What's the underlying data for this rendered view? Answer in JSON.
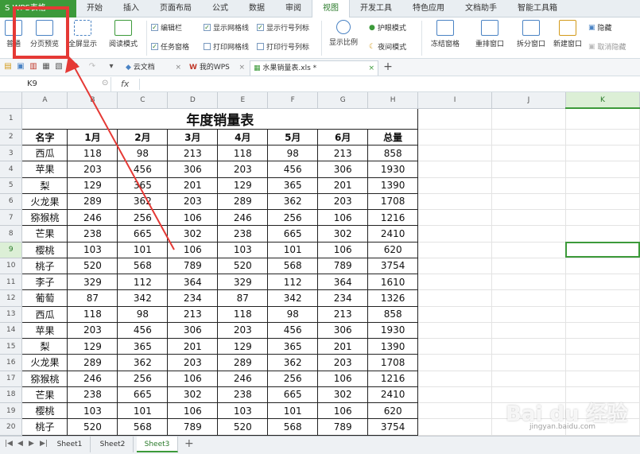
{
  "app": {
    "name": "S WPS表格"
  },
  "menu": {
    "tabs": [
      "开始",
      "插入",
      "页面布局",
      "公式",
      "数据",
      "审阅",
      "视图",
      "开发工具",
      "特色应用",
      "文档助手",
      "智能工具箱"
    ],
    "active": "视图"
  },
  "ribbon": {
    "normal": "普通",
    "page_break_preview": "分页预览",
    "full_screen": "全屏显示",
    "reading_mode": "阅读模式",
    "edit_bar": "编辑栏",
    "task_pane": "任务窗格",
    "show_gridlines": "显示网格线",
    "print_gridlines": "打印网格线",
    "show_row_col_headers": "显示行号列标",
    "print_row_col_headers": "打印行号列标",
    "zoom": "显示比例",
    "eye_protection": "护眼模式",
    "night_mode": "夜间模式",
    "freeze_panes": "冻结窗格",
    "arrange_windows": "重排窗口",
    "split_window": "拆分窗口",
    "new_window": "新建窗口",
    "hide": "隐藏",
    "unhide": "取消隐藏"
  },
  "doc_tabs": [
    {
      "label": "云文档"
    },
    {
      "label": "我的WPS"
    },
    {
      "label": "水果销量表.xls *"
    }
  ],
  "formula_bar": {
    "cell_ref": "K9",
    "fx": "fx",
    "content": ""
  },
  "sheet": {
    "col_headers": [
      "A",
      "B",
      "C",
      "D",
      "E",
      "F",
      "G",
      "H",
      "I",
      "J",
      "K"
    ],
    "title": "年度销量表",
    "header": [
      "名字",
      "1月",
      "2月",
      "3月",
      "4月",
      "5月",
      "6月",
      "总量"
    ],
    "rows": [
      [
        "西瓜",
        "118",
        "98",
        "213",
        "118",
        "98",
        "213",
        "858"
      ],
      [
        "苹果",
        "203",
        "456",
        "306",
        "203",
        "456",
        "306",
        "1930"
      ],
      [
        "梨",
        "129",
        "365",
        "201",
        "129",
        "365",
        "201",
        "1390"
      ],
      [
        "火龙果",
        "289",
        "362",
        "203",
        "289",
        "362",
        "203",
        "1708"
      ],
      [
        "猕猴桃",
        "246",
        "256",
        "106",
        "246",
        "256",
        "106",
        "1216"
      ],
      [
        "芒果",
        "238",
        "665",
        "302",
        "238",
        "665",
        "302",
        "2410"
      ],
      [
        "樱桃",
        "103",
        "101",
        "106",
        "103",
        "101",
        "106",
        "620"
      ],
      [
        "桃子",
        "520",
        "568",
        "789",
        "520",
        "568",
        "789",
        "3754"
      ],
      [
        "李子",
        "329",
        "112",
        "364",
        "329",
        "112",
        "364",
        "1610"
      ],
      [
        "葡萄",
        "87",
        "342",
        "234",
        "87",
        "342",
        "234",
        "1326"
      ],
      [
        "西瓜",
        "118",
        "98",
        "213",
        "118",
        "98",
        "213",
        "858"
      ],
      [
        "苹果",
        "203",
        "456",
        "306",
        "203",
        "456",
        "306",
        "1930"
      ],
      [
        "梨",
        "129",
        "365",
        "201",
        "129",
        "365",
        "201",
        "1390"
      ],
      [
        "火龙果",
        "289",
        "362",
        "203",
        "289",
        "362",
        "203",
        "1708"
      ],
      [
        "猕猴桃",
        "246",
        "256",
        "106",
        "246",
        "256",
        "106",
        "1216"
      ],
      [
        "芒果",
        "238",
        "665",
        "302",
        "238",
        "665",
        "302",
        "2410"
      ],
      [
        "樱桃",
        "103",
        "101",
        "106",
        "103",
        "101",
        "106",
        "620"
      ],
      [
        "桃子",
        "520",
        "568",
        "789",
        "520",
        "568",
        "789",
        "3754"
      ]
    ],
    "selected_cell": "K9"
  },
  "sheet_tabs": [
    "Sheet1",
    "Sheet2",
    "Sheet3"
  ],
  "active_sheet": "Sheet3",
  "watermark": {
    "brand": "Bai du 经验",
    "sub": "jingyan.baidu.com"
  },
  "colors": {
    "accent": "#3c9a3a",
    "annotation": "#e53935"
  }
}
